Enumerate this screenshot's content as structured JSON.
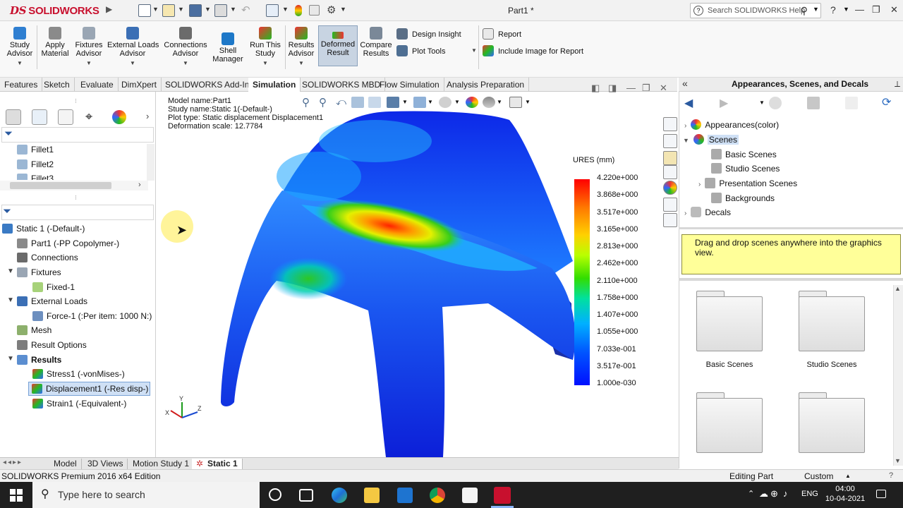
{
  "app": {
    "logo_text": "SOLIDWORKS",
    "document_title": "Part1 *"
  },
  "help": {
    "search_placeholder": "Search SOLIDWORKS Help"
  },
  "command_manager": {
    "commands": [
      {
        "label": "Study\nAdvisor",
        "icon": "study-advisor-icon"
      },
      {
        "label": "Apply\nMaterial",
        "icon": "apply-material-icon"
      },
      {
        "label": "Fixtures\nAdvisor",
        "icon": "fixtures-advisor-icon"
      },
      {
        "label": "External Loads\nAdvisor",
        "icon": "external-loads-icon"
      },
      {
        "label": "Connections\nAdvisor",
        "icon": "connections-icon"
      },
      {
        "label": "Shell\nManager",
        "icon": "shell-manager-icon"
      },
      {
        "label": "Run This\nStudy",
        "icon": "run-study-icon"
      },
      {
        "label": "Results\nAdvisor",
        "icon": "results-advisor-icon"
      },
      {
        "label": "Deformed\nResult",
        "icon": "deformed-result-icon"
      },
      {
        "label": "Compare\nResults",
        "icon": "compare-results-icon"
      }
    ],
    "design_insight": "Design Insight",
    "plot_tools": "Plot Tools",
    "report": "Report",
    "include_image": "Include Image for Report"
  },
  "tabs": [
    "Features",
    "Sketch",
    "Evaluate",
    "DimXpert",
    "SOLIDWORKS Add-Ins",
    "Simulation",
    "SOLIDWORKS MBD",
    "Flow Simulation",
    "Analysis Preparation"
  ],
  "active_tab": "Simulation",
  "feature_tree": {
    "items": [
      "Fillet1",
      "Fillet2",
      "Fillet3"
    ]
  },
  "sim_tree": {
    "study": "Static 1 (-Default-)",
    "part": "Part1 (-PP Copolymer-)",
    "connections": "Connections",
    "fixtures": "Fixtures",
    "fixed": "Fixed-1",
    "external_loads": "External Loads",
    "force": "Force-1 (:Per item: 1000 N:)",
    "mesh": "Mesh",
    "result_options": "Result Options",
    "results": "Results",
    "stress": "Stress1 (-vonMises-)",
    "displacement": "Displacement1 (-Res disp-)",
    "strain": "Strain1 (-Equivalent-)"
  },
  "plot_info": {
    "model_name": "Model name:Part1",
    "study_name": "Study name:Static 1(-Default-)",
    "plot_type": "Plot type: Static displacement Displacement1",
    "deformation_scale": "Deformation scale: 12.7784"
  },
  "legend": {
    "title": "URES (mm)",
    "ticks": [
      "4.220e+000",
      "3.868e+000",
      "3.517e+000",
      "3.165e+000",
      "2.813e+000",
      "2.462e+000",
      "2.110e+000",
      "1.758e+000",
      "1.407e+000",
      "1.055e+000",
      "7.033e-001",
      "3.517e-001",
      "1.000e-030"
    ]
  },
  "task_pane": {
    "title": "Appearances, Scenes, and Decals",
    "appearances": "Appearances(color)",
    "scenes": "Scenes",
    "basic_scenes": "Basic Scenes",
    "studio_scenes": "Studio Scenes",
    "presentation_scenes": "Presentation Scenes",
    "backgrounds": "Backgrounds",
    "decals": "Decals",
    "hint": "Drag and drop scenes anywhere into the graphics view.",
    "folders": [
      "Basic Scenes",
      "Studio Scenes"
    ]
  },
  "bottom_tabs": [
    "Model",
    "3D Views",
    "Motion Study 1",
    "Static 1"
  ],
  "status": {
    "edition": "SOLIDWORKS Premium 2016 x64 Edition",
    "mode": "Editing Part",
    "units": "Custom"
  },
  "taskbar": {
    "search_placeholder": "Type here to search",
    "language": "ENG",
    "time": "04:00",
    "date": "10-04-2021"
  },
  "colors": {
    "accent": "#c8102e",
    "selection": "#cfe0f5",
    "hint_bg": "#ffff99"
  }
}
